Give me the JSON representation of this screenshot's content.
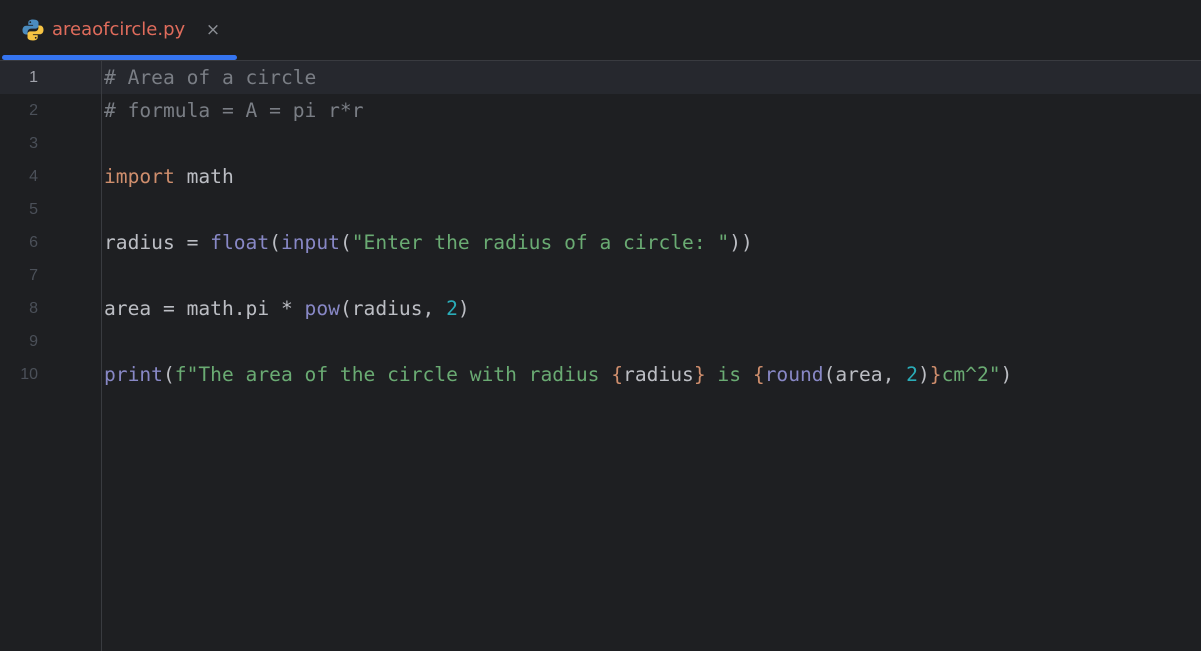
{
  "tab": {
    "filename": "areaofcircle.py",
    "icon": "python-icon",
    "close_symbol": "×"
  },
  "colors": {
    "background": "#1e1f22",
    "current_line": "#26282e",
    "tab_indicator": "#3574f0",
    "tab_title": "#e06c5c",
    "comment": "#7a7e85",
    "keyword": "#cf8e6d",
    "builtin": "#8888c6",
    "string": "#6aab73",
    "number": "#2aacb8",
    "default": "#bcbec4",
    "line_number": "#4b5059"
  },
  "editor": {
    "current_line_number": 1,
    "lines": [
      {
        "number": "1",
        "tokens": [
          {
            "t": "comment",
            "v": "# Area of a circle"
          }
        ]
      },
      {
        "number": "2",
        "tokens": [
          {
            "t": "comment",
            "v": "# formula = A = pi r*r"
          }
        ]
      },
      {
        "number": "3",
        "tokens": []
      },
      {
        "number": "4",
        "tokens": [
          {
            "t": "keyword",
            "v": "import"
          },
          {
            "t": "default",
            "v": " math"
          }
        ]
      },
      {
        "number": "5",
        "tokens": []
      },
      {
        "number": "6",
        "tokens": [
          {
            "t": "default",
            "v": "radius = "
          },
          {
            "t": "builtin",
            "v": "float"
          },
          {
            "t": "default",
            "v": "("
          },
          {
            "t": "builtin",
            "v": "input"
          },
          {
            "t": "default",
            "v": "("
          },
          {
            "t": "string",
            "v": "\"Enter the radius of a circle: \""
          },
          {
            "t": "default",
            "v": "))"
          }
        ]
      },
      {
        "number": "7",
        "tokens": []
      },
      {
        "number": "8",
        "tokens": [
          {
            "t": "default",
            "v": "area = math.pi * "
          },
          {
            "t": "builtin",
            "v": "pow"
          },
          {
            "t": "default",
            "v": "(radius, "
          },
          {
            "t": "number",
            "v": "2"
          },
          {
            "t": "default",
            "v": ")"
          }
        ]
      },
      {
        "number": "9",
        "tokens": []
      },
      {
        "number": "10",
        "tokens": [
          {
            "t": "builtin",
            "v": "print"
          },
          {
            "t": "default",
            "v": "("
          },
          {
            "t": "string",
            "v": "f\"The area of the circle with radius "
          },
          {
            "t": "brace",
            "v": "{"
          },
          {
            "t": "default",
            "v": "radius"
          },
          {
            "t": "brace",
            "v": "}"
          },
          {
            "t": "string",
            "v": " is "
          },
          {
            "t": "brace",
            "v": "{"
          },
          {
            "t": "builtin",
            "v": "round"
          },
          {
            "t": "default",
            "v": "(area, "
          },
          {
            "t": "number",
            "v": "2"
          },
          {
            "t": "default",
            "v": ")"
          },
          {
            "t": "brace",
            "v": "}"
          },
          {
            "t": "string",
            "v": "cm^2\""
          },
          {
            "t": "default",
            "v": ")"
          }
        ]
      }
    ]
  }
}
